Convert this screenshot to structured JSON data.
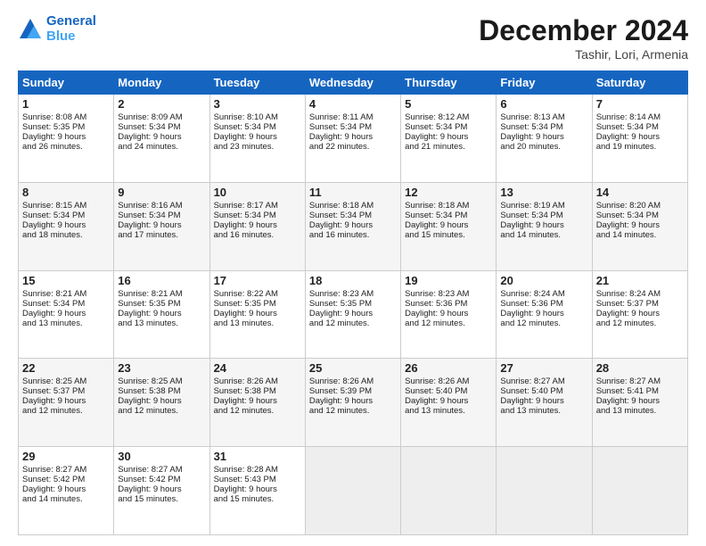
{
  "header": {
    "logo_line1": "General",
    "logo_line2": "Blue",
    "month": "December 2024",
    "location": "Tashir, Lori, Armenia"
  },
  "days_of_week": [
    "Sunday",
    "Monday",
    "Tuesday",
    "Wednesday",
    "Thursday",
    "Friday",
    "Saturday"
  ],
  "weeks": [
    [
      {
        "day": "1",
        "lines": [
          "Sunrise: 8:08 AM",
          "Sunset: 5:35 PM",
          "Daylight: 9 hours",
          "and 26 minutes."
        ]
      },
      {
        "day": "2",
        "lines": [
          "Sunrise: 8:09 AM",
          "Sunset: 5:34 PM",
          "Daylight: 9 hours",
          "and 24 minutes."
        ]
      },
      {
        "day": "3",
        "lines": [
          "Sunrise: 8:10 AM",
          "Sunset: 5:34 PM",
          "Daylight: 9 hours",
          "and 23 minutes."
        ]
      },
      {
        "day": "4",
        "lines": [
          "Sunrise: 8:11 AM",
          "Sunset: 5:34 PM",
          "Daylight: 9 hours",
          "and 22 minutes."
        ]
      },
      {
        "day": "5",
        "lines": [
          "Sunrise: 8:12 AM",
          "Sunset: 5:34 PM",
          "Daylight: 9 hours",
          "and 21 minutes."
        ]
      },
      {
        "day": "6",
        "lines": [
          "Sunrise: 8:13 AM",
          "Sunset: 5:34 PM",
          "Daylight: 9 hours",
          "and 20 minutes."
        ]
      },
      {
        "day": "7",
        "lines": [
          "Sunrise: 8:14 AM",
          "Sunset: 5:34 PM",
          "Daylight: 9 hours",
          "and 19 minutes."
        ]
      }
    ],
    [
      {
        "day": "8",
        "lines": [
          "Sunrise: 8:15 AM",
          "Sunset: 5:34 PM",
          "Daylight: 9 hours",
          "and 18 minutes."
        ]
      },
      {
        "day": "9",
        "lines": [
          "Sunrise: 8:16 AM",
          "Sunset: 5:34 PM",
          "Daylight: 9 hours",
          "and 17 minutes."
        ]
      },
      {
        "day": "10",
        "lines": [
          "Sunrise: 8:17 AM",
          "Sunset: 5:34 PM",
          "Daylight: 9 hours",
          "and 16 minutes."
        ]
      },
      {
        "day": "11",
        "lines": [
          "Sunrise: 8:18 AM",
          "Sunset: 5:34 PM",
          "Daylight: 9 hours",
          "and 16 minutes."
        ]
      },
      {
        "day": "12",
        "lines": [
          "Sunrise: 8:18 AM",
          "Sunset: 5:34 PM",
          "Daylight: 9 hours",
          "and 15 minutes."
        ]
      },
      {
        "day": "13",
        "lines": [
          "Sunrise: 8:19 AM",
          "Sunset: 5:34 PM",
          "Daylight: 9 hours",
          "and 14 minutes."
        ]
      },
      {
        "day": "14",
        "lines": [
          "Sunrise: 8:20 AM",
          "Sunset: 5:34 PM",
          "Daylight: 9 hours",
          "and 14 minutes."
        ]
      }
    ],
    [
      {
        "day": "15",
        "lines": [
          "Sunrise: 8:21 AM",
          "Sunset: 5:34 PM",
          "Daylight: 9 hours",
          "and 13 minutes."
        ]
      },
      {
        "day": "16",
        "lines": [
          "Sunrise: 8:21 AM",
          "Sunset: 5:35 PM",
          "Daylight: 9 hours",
          "and 13 minutes."
        ]
      },
      {
        "day": "17",
        "lines": [
          "Sunrise: 8:22 AM",
          "Sunset: 5:35 PM",
          "Daylight: 9 hours",
          "and 13 minutes."
        ]
      },
      {
        "day": "18",
        "lines": [
          "Sunrise: 8:23 AM",
          "Sunset: 5:35 PM",
          "Daylight: 9 hours",
          "and 12 minutes."
        ]
      },
      {
        "day": "19",
        "lines": [
          "Sunrise: 8:23 AM",
          "Sunset: 5:36 PM",
          "Daylight: 9 hours",
          "and 12 minutes."
        ]
      },
      {
        "day": "20",
        "lines": [
          "Sunrise: 8:24 AM",
          "Sunset: 5:36 PM",
          "Daylight: 9 hours",
          "and 12 minutes."
        ]
      },
      {
        "day": "21",
        "lines": [
          "Sunrise: 8:24 AM",
          "Sunset: 5:37 PM",
          "Daylight: 9 hours",
          "and 12 minutes."
        ]
      }
    ],
    [
      {
        "day": "22",
        "lines": [
          "Sunrise: 8:25 AM",
          "Sunset: 5:37 PM",
          "Daylight: 9 hours",
          "and 12 minutes."
        ]
      },
      {
        "day": "23",
        "lines": [
          "Sunrise: 8:25 AM",
          "Sunset: 5:38 PM",
          "Daylight: 9 hours",
          "and 12 minutes."
        ]
      },
      {
        "day": "24",
        "lines": [
          "Sunrise: 8:26 AM",
          "Sunset: 5:38 PM",
          "Daylight: 9 hours",
          "and 12 minutes."
        ]
      },
      {
        "day": "25",
        "lines": [
          "Sunrise: 8:26 AM",
          "Sunset: 5:39 PM",
          "Daylight: 9 hours",
          "and 12 minutes."
        ]
      },
      {
        "day": "26",
        "lines": [
          "Sunrise: 8:26 AM",
          "Sunset: 5:40 PM",
          "Daylight: 9 hours",
          "and 13 minutes."
        ]
      },
      {
        "day": "27",
        "lines": [
          "Sunrise: 8:27 AM",
          "Sunset: 5:40 PM",
          "Daylight: 9 hours",
          "and 13 minutes."
        ]
      },
      {
        "day": "28",
        "lines": [
          "Sunrise: 8:27 AM",
          "Sunset: 5:41 PM",
          "Daylight: 9 hours",
          "and 13 minutes."
        ]
      }
    ],
    [
      {
        "day": "29",
        "lines": [
          "Sunrise: 8:27 AM",
          "Sunset: 5:42 PM",
          "Daylight: 9 hours",
          "and 14 minutes."
        ]
      },
      {
        "day": "30",
        "lines": [
          "Sunrise: 8:27 AM",
          "Sunset: 5:42 PM",
          "Daylight: 9 hours",
          "and 15 minutes."
        ]
      },
      {
        "day": "31",
        "lines": [
          "Sunrise: 8:28 AM",
          "Sunset: 5:43 PM",
          "Daylight: 9 hours",
          "and 15 minutes."
        ]
      },
      null,
      null,
      null,
      null
    ]
  ]
}
